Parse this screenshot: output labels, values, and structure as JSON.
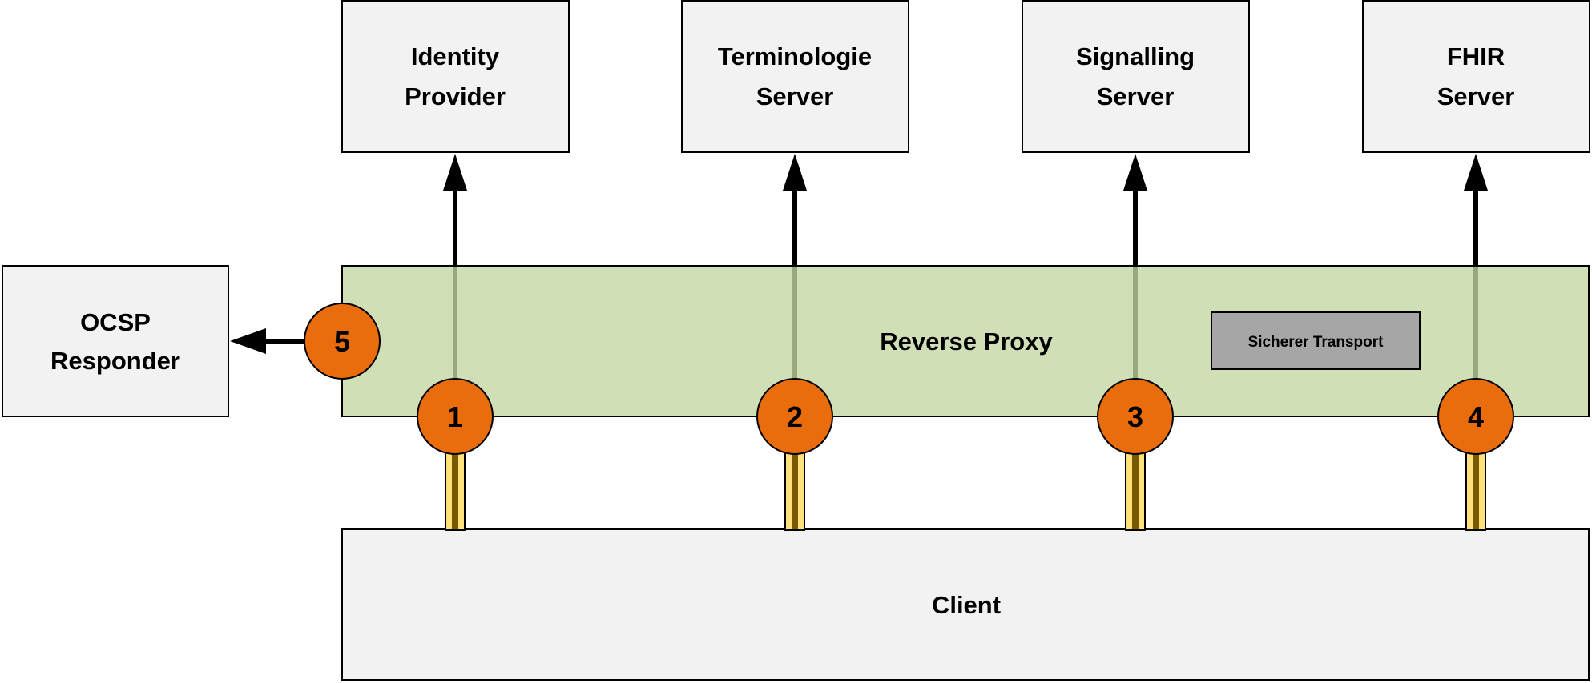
{
  "colors": {
    "box_fill": "#f2f2f2",
    "proxy_fill": "#d0dfb6",
    "marker_fill": "#e96d0c",
    "legend_fill": "#a6a6a6",
    "tube_fill": "#ffe07a",
    "tube_core": "#7a5a00"
  },
  "servers": [
    {
      "line1": "Identity",
      "line2": "Provider",
      "marker": "1"
    },
    {
      "line1": "Terminologie",
      "line2": "Server",
      "marker": "2"
    },
    {
      "line1": "Signalling",
      "line2": "Server",
      "marker": "3"
    },
    {
      "line1": "FHIR",
      "line2": "Server",
      "marker": "4"
    }
  ],
  "ocsp": {
    "line1": "OCSP",
    "line2": "Responder",
    "marker": "5"
  },
  "proxy": {
    "label": "Reverse Proxy"
  },
  "legend": {
    "label": "Sicherer Transport"
  },
  "client": {
    "label": "Client"
  }
}
